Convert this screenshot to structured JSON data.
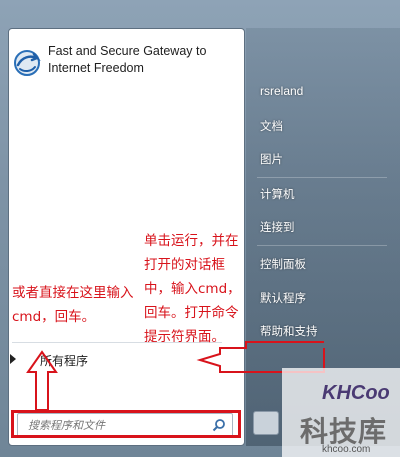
{
  "pinned_app": {
    "title": "Fast and Secure Gateway to Internet Freedom",
    "icon": "globe-arrow-icon"
  },
  "all_programs": {
    "label": "所有程序",
    "icon": "triangle-right-icon"
  },
  "search": {
    "placeholder": "搜索程序和文件",
    "icon": "magnifier-icon"
  },
  "right_menu": {
    "items": [
      {
        "label": "rsreland"
      },
      {
        "label": "文档"
      },
      {
        "label": "图片"
      },
      {
        "label": "计算机"
      },
      {
        "label": "连接到"
      },
      {
        "label": "控制面板"
      },
      {
        "label": "默认程序"
      },
      {
        "label": "帮助和支持"
      }
    ]
  },
  "annotations": {
    "left": "或者直接在这里输入cmd，回车。",
    "right": "单击运行，并在打开的对话框中，输入cmd，回车。打开命令提示符界面。"
  },
  "watermark": {
    "logo": "KHCoo",
    "name": "科技库",
    "url": "khcoo.com"
  },
  "colors": {
    "annotation": "#d8131b",
    "panel": "#ffffff"
  }
}
